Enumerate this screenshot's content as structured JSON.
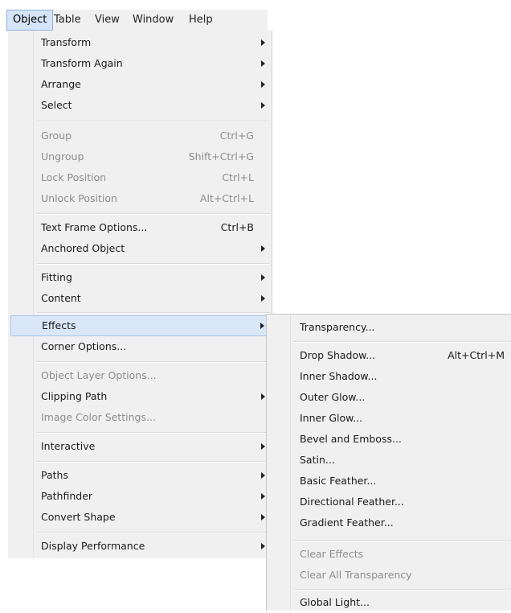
{
  "menubar": {
    "items": [
      "Object",
      "Table",
      "View",
      "Window",
      "Help"
    ],
    "active": "Object"
  },
  "object_menu": {
    "items": [
      {
        "label": "Transform",
        "shortcut": "",
        "submenu": true,
        "enabled": true
      },
      {
        "label": "Transform Again",
        "shortcut": "",
        "submenu": true,
        "enabled": true
      },
      {
        "label": "Arrange",
        "shortcut": "",
        "submenu": true,
        "enabled": true
      },
      {
        "label": "Select",
        "shortcut": "",
        "submenu": true,
        "enabled": true
      },
      {
        "label": "Group",
        "shortcut": "Ctrl+G",
        "submenu": false,
        "enabled": false
      },
      {
        "label": "Ungroup",
        "shortcut": "Shift+Ctrl+G",
        "submenu": false,
        "enabled": false
      },
      {
        "label": "Lock Position",
        "shortcut": "Ctrl+L",
        "submenu": false,
        "enabled": false
      },
      {
        "label": "Unlock Position",
        "shortcut": "Alt+Ctrl+L",
        "submenu": false,
        "enabled": false
      },
      {
        "label": "Text Frame Options...",
        "shortcut": "Ctrl+B",
        "submenu": false,
        "enabled": true
      },
      {
        "label": "Anchored Object",
        "shortcut": "",
        "submenu": true,
        "enabled": true
      },
      {
        "label": "Fitting",
        "shortcut": "",
        "submenu": true,
        "enabled": true
      },
      {
        "label": "Content",
        "shortcut": "",
        "submenu": true,
        "enabled": true
      },
      {
        "label": "Effects",
        "shortcut": "",
        "submenu": true,
        "enabled": true,
        "highlighted": true
      },
      {
        "label": "Corner Options...",
        "shortcut": "",
        "submenu": false,
        "enabled": true
      },
      {
        "label": "Object Layer Options...",
        "shortcut": "",
        "submenu": false,
        "enabled": false
      },
      {
        "label": "Clipping Path",
        "shortcut": "",
        "submenu": true,
        "enabled": true
      },
      {
        "label": "Image Color Settings...",
        "shortcut": "",
        "submenu": false,
        "enabled": false
      },
      {
        "label": "Interactive",
        "shortcut": "",
        "submenu": true,
        "enabled": true
      },
      {
        "label": "Paths",
        "shortcut": "",
        "submenu": true,
        "enabled": true
      },
      {
        "label": "Pathfinder",
        "shortcut": "",
        "submenu": true,
        "enabled": true
      },
      {
        "label": "Convert Shape",
        "shortcut": "",
        "submenu": true,
        "enabled": true
      },
      {
        "label": "Display Performance",
        "shortcut": "",
        "submenu": true,
        "enabled": true
      }
    ]
  },
  "effects_submenu": {
    "items": [
      {
        "label": "Transparency...",
        "shortcut": "",
        "enabled": true
      },
      {
        "label": "Drop Shadow...",
        "shortcut": "Alt+Ctrl+M",
        "enabled": true
      },
      {
        "label": "Inner Shadow...",
        "shortcut": "",
        "enabled": true
      },
      {
        "label": "Outer Glow...",
        "shortcut": "",
        "enabled": true
      },
      {
        "label": "Inner Glow...",
        "shortcut": "",
        "enabled": true
      },
      {
        "label": "Bevel and Emboss...",
        "shortcut": "",
        "enabled": true
      },
      {
        "label": "Satin...",
        "shortcut": "",
        "enabled": true
      },
      {
        "label": "Basic Feather...",
        "shortcut": "",
        "enabled": true
      },
      {
        "label": "Directional Feather...",
        "shortcut": "",
        "enabled": true
      },
      {
        "label": "Gradient Feather...",
        "shortcut": "",
        "enabled": true
      },
      {
        "label": "Clear Effects",
        "shortcut": "",
        "enabled": false
      },
      {
        "label": "Clear All Transparency",
        "shortcut": "",
        "enabled": false
      },
      {
        "label": "Global Light...",
        "shortcut": "",
        "enabled": true
      }
    ]
  },
  "colors": {
    "menu_bg": "#f0f0f0",
    "highlight_bg": "#d9e7f8",
    "highlight_border": "#a9c6ec",
    "disabled_text": "#8d8d8d"
  }
}
